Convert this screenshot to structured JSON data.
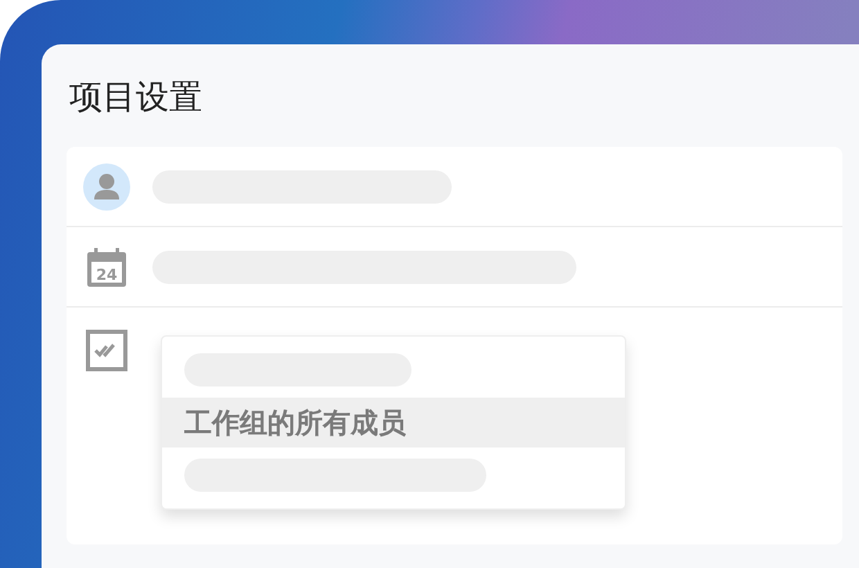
{
  "title": "项目设置",
  "rows": [
    {
      "kind": "avatar"
    },
    {
      "kind": "date",
      "day": "24"
    },
    {
      "kind": "checklist"
    }
  ],
  "dropdown": {
    "items": [
      {
        "kind": "skeleton"
      },
      {
        "kind": "option",
        "label": "工作组的所有成员",
        "selected": true
      },
      {
        "kind": "skeleton"
      }
    ]
  }
}
